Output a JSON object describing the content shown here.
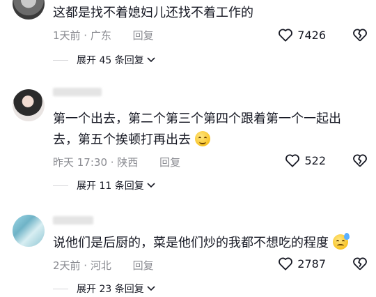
{
  "comments": [
    {
      "text": "这都是找不着媳妇儿还找不着工作的",
      "meta": "1天前 · 广东",
      "reply_label": "回复",
      "likes": "7426",
      "expand": "展开 45 条回复"
    },
    {
      "text": "第一个出去，第二个第三个第四个跟着第一个一起出去，第五个挨顿打再出去",
      "meta": "昨天 17:30 · 陕西",
      "reply_label": "回复",
      "likes": "522",
      "expand": "展开 11 条回复"
    },
    {
      "text": "说他们是后厨的，菜是他们炒的我都不想吃的程度",
      "meta": "2天前 · 河北",
      "reply_label": "回复",
      "likes": "2787",
      "expand": "展开 23 条回复"
    }
  ],
  "icons": {
    "like": "heart-outline-icon",
    "dislike": "broken-heart-icon",
    "expand": "chevron-down-icon",
    "emoji_smile": "smile-emoji-icon",
    "emoji_sweat": "sweat-emoji-icon"
  }
}
